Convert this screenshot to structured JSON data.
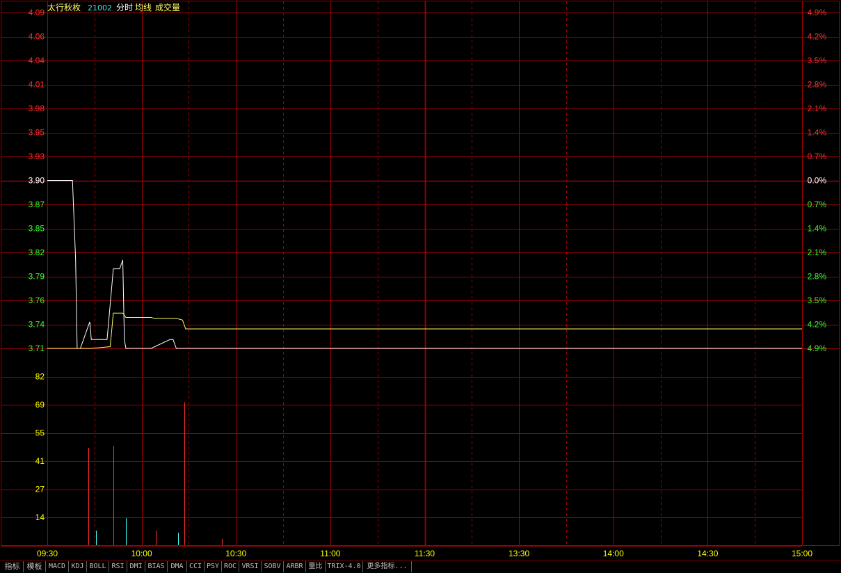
{
  "header": {
    "stock_name": "太行秋枚",
    "stock_code": "21002",
    "legend_1": "分时",
    "legend_2": "均线",
    "legend_3": "成交量"
  },
  "colors": {
    "background": "#000000",
    "grid": "#a00000",
    "price_line": "#ffffff",
    "avg_line": "#ffff66",
    "up": "#ff3030",
    "down": "#30ff30",
    "neutral": "#ffffff",
    "volume_label": "#ffff00",
    "time_label": "#ffff00",
    "cyan": "#40ffff"
  },
  "tabs": [
    "指标",
    "模板",
    "MACD",
    "KDJ",
    "BOLL",
    "RSI",
    "DMI",
    "BIAS",
    "DMA",
    "CCI",
    "PSY",
    "ROC",
    "VRSI",
    "SOBV",
    "ARBR",
    "量比",
    "TRIX-4.0",
    "更多指标..."
  ],
  "chart_data": {
    "type": "line",
    "reference_price": 3.9,
    "price_ticks": [
      "4.09",
      "4.06",
      "4.04",
      "4.01",
      "3.98",
      "3.95",
      "3.93",
      "3.90",
      "3.87",
      "3.85",
      "3.82",
      "3.79",
      "3.76",
      "3.74",
      "3.71"
    ],
    "percent_ticks": [
      "4.9%",
      "4.2%",
      "3.5%",
      "2.8%",
      "2.1%",
      "1.4%",
      "0.7%",
      "0.0%",
      "0.7%",
      "1.4%",
      "2.1%",
      "2.8%",
      "3.5%",
      "4.2%",
      "4.9%"
    ],
    "volume_ticks": [
      "82",
      "69",
      "55",
      "41",
      "27",
      "14"
    ],
    "time_ticks": [
      "09:30",
      "10:00",
      "10:30",
      "11:00",
      "11:30",
      "13:30",
      "14:00",
      "14:30",
      "15:00"
    ],
    "ylim": [
      3.71,
      4.09
    ],
    "volume_max": 95,
    "series": [
      {
        "key": "price",
        "x": [
          0,
          8,
          9,
          9.5,
          10.5,
          13.5,
          14,
          14.5,
          16,
          19,
          19.5,
          21,
          23,
          24,
          24.5,
          25,
          27,
          31,
          33,
          39,
          40,
          41,
          240
        ],
        "values": [
          3.9,
          3.9,
          3.81,
          3.71,
          3.71,
          3.74,
          3.72,
          3.72,
          3.72,
          3.72,
          3.74,
          3.8,
          3.8,
          3.81,
          3.72,
          3.71,
          3.71,
          3.71,
          3.71,
          3.72,
          3.72,
          3.71,
          3.71
        ]
      },
      {
        "key": "avg",
        "x": [
          0,
          10,
          14,
          20,
          21,
          24,
          25,
          33,
          34,
          41,
          43,
          44,
          55,
          240
        ],
        "values": [
          3.71,
          3.71,
          3.71,
          3.712,
          3.75,
          3.75,
          3.745,
          3.745,
          3.744,
          3.744,
          3.742,
          3.732,
          3.732,
          3.732
        ]
      }
    ],
    "volume": [
      {
        "x": 13,
        "v": 47,
        "color": "up"
      },
      {
        "x": 15.5,
        "v": 7,
        "color": "cyan"
      },
      {
        "x": 21,
        "v": 48,
        "color": "up"
      },
      {
        "x": 25,
        "v": 13,
        "color": "cyan"
      },
      {
        "x": 34.5,
        "v": 7,
        "color": "up"
      },
      {
        "x": 41.5,
        "v": 6,
        "color": "cyan"
      },
      {
        "x": 43.5,
        "v": 69,
        "color": "up"
      },
      {
        "x": 55.5,
        "v": 3,
        "color": "up"
      }
    ]
  }
}
